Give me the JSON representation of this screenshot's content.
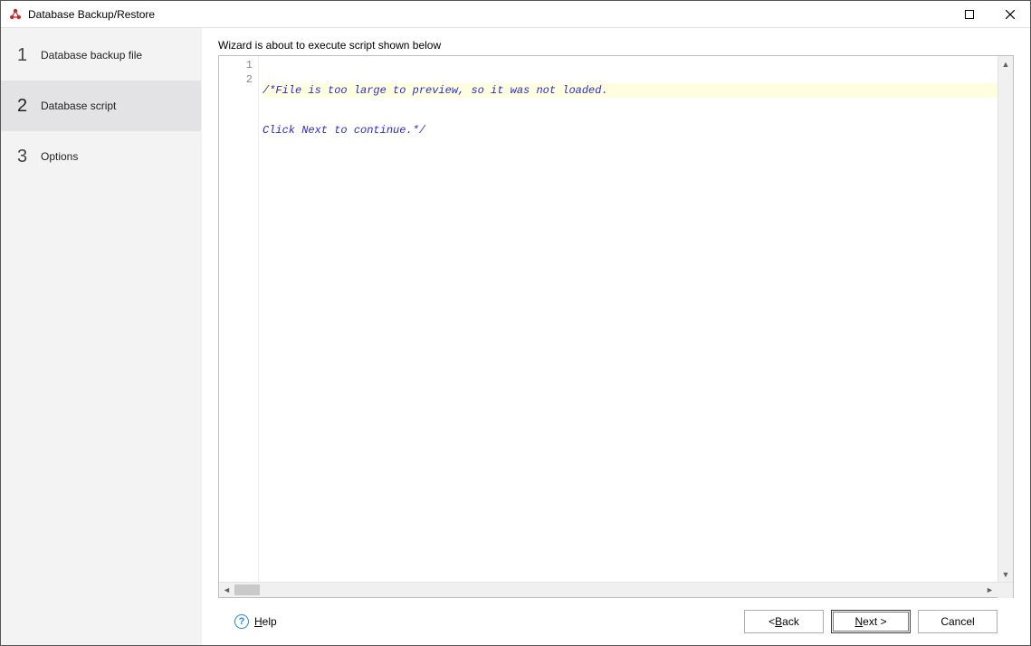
{
  "window": {
    "title": "Database Backup/Restore"
  },
  "sidebar": {
    "steps": [
      {
        "num": "1",
        "label": "Database backup file"
      },
      {
        "num": "2",
        "label": "Database script"
      },
      {
        "num": "3",
        "label": "Options"
      }
    ],
    "active_index": 1
  },
  "main": {
    "instruction": "Wizard is about to execute script shown below",
    "code_lines": [
      "/*File is too large to preview, so it was not loaded.",
      "Click Next to continue.*/"
    ]
  },
  "footer": {
    "help": "Help",
    "back": "< Back",
    "next": "Next >",
    "cancel": "Cancel"
  }
}
